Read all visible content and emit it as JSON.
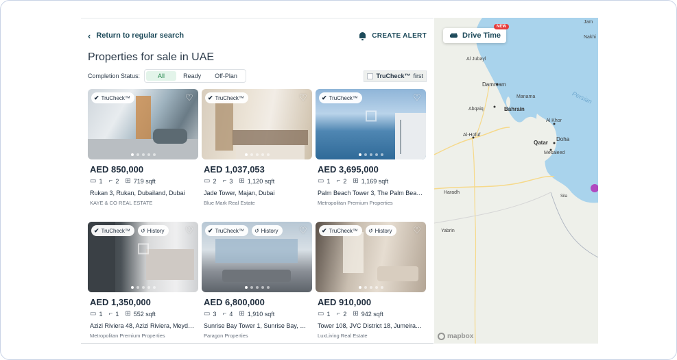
{
  "header": {
    "back_label": "Return to regular search",
    "alert_label": "CREATE ALERT",
    "title": "Properties for sale in UAE"
  },
  "filters": {
    "label": "Completion Status:",
    "options": [
      "All",
      "Ready",
      "Off-Plan"
    ],
    "selected": "All",
    "trucheck_first_brand": "TruCheck™",
    "trucheck_first_suffix": "first"
  },
  "listings": [
    {
      "trucheck": "TruCheck™",
      "history": "",
      "price": "AED 850,000",
      "beds": "1",
      "baths": "2",
      "area": "719 sqft",
      "location": "Rukan 3, Rukan, Dubailand, Dubai",
      "agent": "KAYE & CO REAL ESTATE"
    },
    {
      "trucheck": "TruCheck™",
      "history": "",
      "price": "AED 1,037,053",
      "beds": "2",
      "baths": "3",
      "area": "1,120 sqft",
      "location": "Jade Tower, Majan, Dubai",
      "agent": "Blue Mark Real Estate"
    },
    {
      "trucheck": "TruCheck™",
      "history": "",
      "price": "AED 3,695,000",
      "beds": "1",
      "baths": "2",
      "area": "1,169 sqft",
      "location": "Palm Beach Tower 3, The Palm Beach ...",
      "agent": "Metropolitan Premium Properties"
    },
    {
      "trucheck": "TruCheck™",
      "history": "History",
      "price": "AED 1,350,000",
      "beds": "1",
      "baths": "1",
      "area": "552 sqft",
      "location": "Azizi Riviera 48, Azizi Riviera, Meyda...",
      "agent": "Metropolitan Premium Properties"
    },
    {
      "trucheck": "TruCheck™",
      "history": "History",
      "price": "AED 6,800,000",
      "beds": "3",
      "baths": "4",
      "area": "1,910 sqft",
      "location": "Sunrise Bay Tower 1, Sunrise Bay, Em...",
      "agent": "Paragon Properties"
    },
    {
      "trucheck": "TruCheck™",
      "history": "History",
      "price": "AED 910,000",
      "beds": "1",
      "baths": "2",
      "area": "942 sqft",
      "location": "Tower 108, JVC District 18, Jumeirah ...",
      "agent": "LuxLiving Real Estate"
    }
  ],
  "map": {
    "drive_time_label": "Drive Time",
    "new_badge": "NEW",
    "attribution": "mapbox",
    "places": [
      "Jam",
      "Nakhi",
      "Al Jubayl",
      "Dammam",
      "Manama",
      "Abqaiq",
      "Bahrain",
      "Persian",
      "Al Khor",
      "Al-Hofuf",
      "Qatar",
      "Doha",
      "Mesaieed",
      "Haradh",
      "Sila",
      "Yabrin"
    ],
    "colors": {
      "water": "#a9d3ec",
      "land": "#eef0ea",
      "road": "#f6d98a"
    }
  },
  "icons": [
    "chevron-left-icon",
    "bell-icon",
    "checkmark-icon",
    "history-icon",
    "heart-icon",
    "bed-icon",
    "bath-icon",
    "area-icon",
    "car-icon",
    "mapbox-logo"
  ]
}
